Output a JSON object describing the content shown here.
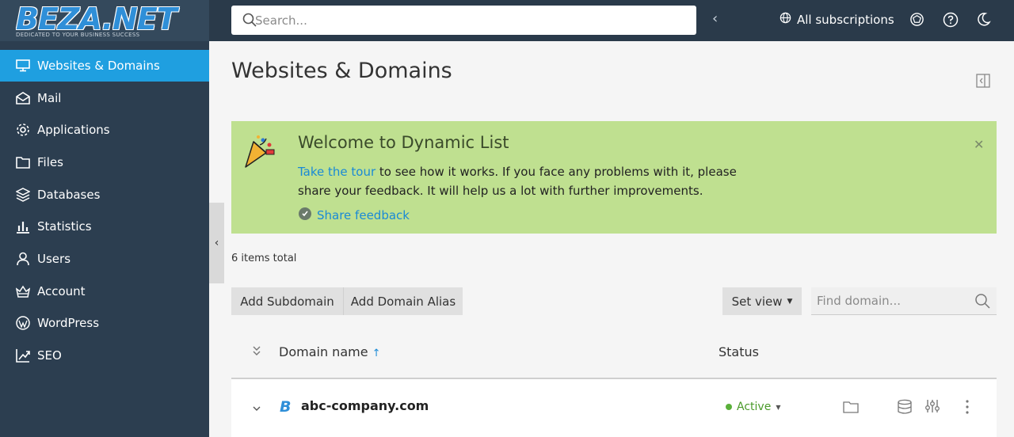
{
  "app": {
    "logo_text": "BEZA.NET",
    "logo_tagline": "DEDICATED TO YOUR BUSINESS SUCCESS"
  },
  "topbar": {
    "search_placeholder": "Search...",
    "subscriptions_label": "All subscriptions",
    "icons": [
      "search-icon",
      "chevron-left-icon",
      "globe-icon",
      "help-icon",
      "moon-icon"
    ]
  },
  "sidebar": {
    "items": [
      {
        "label": "Websites & Domains",
        "icon": "monitor-icon",
        "active": true
      },
      {
        "label": "Mail",
        "icon": "envelope-icon"
      },
      {
        "label": "Applications",
        "icon": "gear-icon"
      },
      {
        "label": "Files",
        "icon": "folder-icon"
      },
      {
        "label": "Databases",
        "icon": "layers-icon"
      },
      {
        "label": "Statistics",
        "icon": "bar-chart-icon"
      },
      {
        "label": "Users",
        "icon": "user-icon"
      },
      {
        "label": "Account",
        "icon": "crown-icon"
      },
      {
        "label": "WordPress",
        "icon": "wordpress-icon"
      },
      {
        "label": "SEO",
        "icon": "trend-icon"
      }
    ]
  },
  "main": {
    "title": "Websites & Domains",
    "banner": {
      "title": "Welcome to Dynamic List",
      "link_text": "Take the tour",
      "body_text": " to see how it works. If you face any problems with it, please share your feedback. It will help us a lot with further improvements.",
      "feedback_label": "Share feedback"
    },
    "items_total": "6 items total",
    "toolbar": {
      "add_subdomain": "Add Subdomain",
      "add_alias": "Add Domain Alias",
      "set_view": "Set view",
      "find_placeholder": "Find domain..."
    },
    "table": {
      "col_domain": "Domain name",
      "col_status": "Status",
      "rows": [
        {
          "domain": "abc-company.com",
          "status": "Active"
        }
      ]
    }
  },
  "colors": {
    "sidebar_bg": "#2c3e50",
    "active_item": "#1f9fe0",
    "banner_bg": "#bfe090",
    "link": "#1a8ad6",
    "status_active": "#5ab03a"
  }
}
